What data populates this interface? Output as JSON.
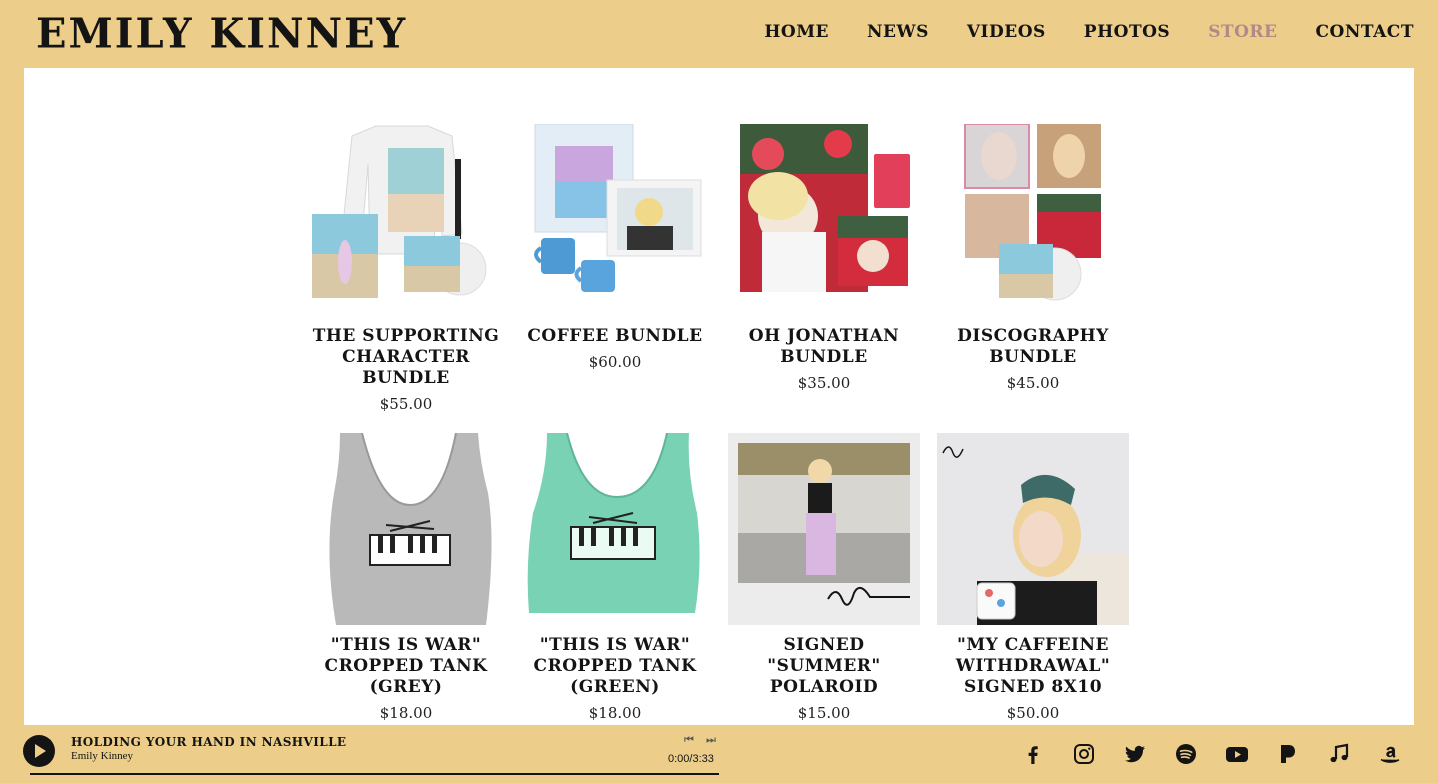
{
  "header": {
    "logo": "EMILY KINNEY",
    "nav": [
      "HOME",
      "NEWS",
      "VIDEOS",
      "PHOTOS",
      "STORE",
      "CONTACT"
    ],
    "active": "STORE",
    "active_color": "#b08a88"
  },
  "products": [
    {
      "name": "THE SUPPORTING CHARACTER BUNDLE",
      "price": "$55.00"
    },
    {
      "name": "COFFEE BUNDLE",
      "price": "$60.00"
    },
    {
      "name": "OH JONATHAN BUNDLE",
      "price": "$35.00"
    },
    {
      "name": "DISCOGRAPHY BUNDLE",
      "price": "$45.00"
    },
    {
      "name": "\"THIS IS WAR\" CROPPED TANK (GREY)",
      "price": "$18.00"
    },
    {
      "name": "\"THIS IS WAR\" CROPPED TANK (GREEN)",
      "price": "$18.00"
    },
    {
      "name": "SIGNED \"SUMMER\" POLAROID",
      "price": "$15.00"
    },
    {
      "name": "\"MY CAFFEINE WITHDRAWAL\" SIGNED 8X10",
      "price": "$50.00"
    }
  ],
  "player": {
    "track_title": "HOLDING YOUR HAND IN NASHVILLE",
    "artist": "Emily Kinney",
    "time": "0:00/3:33",
    "prev_icon": "⏮",
    "next_icon": "⏭"
  },
  "socials": [
    "facebook-icon",
    "instagram-icon",
    "twitter-icon",
    "spotify-icon",
    "youtube-icon",
    "pandora-icon",
    "apple-music-icon",
    "amazon-icon"
  ],
  "colors": {
    "background": "#ecce8a",
    "panel": "#ffffff",
    "text": "#141414"
  }
}
